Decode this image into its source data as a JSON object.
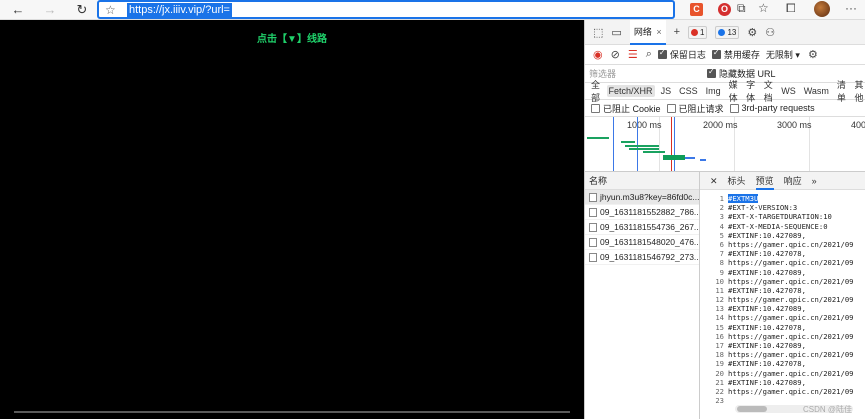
{
  "browser": {
    "url": "https://jx.iiiv.vip/?url=",
    "extensions": [
      {
        "name": "C",
        "color": "#e8542c"
      },
      {
        "name": "O",
        "color": "#d42f2f"
      }
    ],
    "colors": {
      "accent": "#1a73e8"
    }
  },
  "video": {
    "title": "点击【▼】线路"
  },
  "devtools": {
    "tab_network": "网络",
    "errors_badge": "1",
    "messages_badge": "13",
    "toolbar": {
      "preserve_log": "保留日志",
      "disable_cache": "禁用缓存",
      "throttle": "无限制"
    },
    "filter": {
      "placeholder": "筛选器",
      "hide_data_urls": "隐藏数据 URL"
    },
    "types": [
      "全部",
      "Fetch/XHR",
      "JS",
      "CSS",
      "Img",
      "媒体",
      "字体",
      "文档",
      "WS",
      "Wasm",
      "清单",
      "其他"
    ],
    "block": {
      "blocked_cookies": "已阻止 Cookie",
      "blocked_requests": "已阻止请求",
      "third_party": "3rd-party requests"
    },
    "timeline": {
      "labels": [
        "1000 ms",
        "2000 ms",
        "3000 ms",
        "4000"
      ]
    },
    "requests": {
      "header": "名称",
      "items": [
        "jhyun.m3u8?key=86fd0c...",
        "09_1631181552882_786...",
        "09_1631181554736_267...",
        "09_1631181548020_476...",
        "09_1631181546792_273..."
      ]
    },
    "detail": {
      "tabs": [
        "标头",
        "预览",
        "响应"
      ],
      "lines": [
        "#EXTM3U",
        "#EXT-X-VERSION:3",
        "#EXT-X-TARGETDURATION:10",
        "#EXT-X-MEDIA-SEQUENCE:0",
        "#EXTINF:10.427089,",
        "https://gamer.qpic.cn/2021/09",
        "#EXTINF:10.427078,",
        "https://gamer.qpic.cn/2021/09",
        "#EXTINF:10.427089,",
        "https://gamer.qpic.cn/2021/09",
        "#EXTINF:10.427078,",
        "https://gamer.qpic.cn/2021/09",
        "#EXTINF:10.427089,",
        "https://gamer.qpic.cn/2021/09",
        "#EXTINF:10.427078,",
        "https://gamer.qpic.cn/2021/09",
        "#EXTINF:10.427089,",
        "https://gamer.qpic.cn/2021/09",
        "#EXTINF:10.427078,",
        "https://gamer.qpic.cn/2021/09",
        "#EXTINF:10.427089,",
        "https://gamer.qpic.cn/2021/09",
        ""
      ]
    }
  },
  "watermark": "CSDN @陆佳"
}
